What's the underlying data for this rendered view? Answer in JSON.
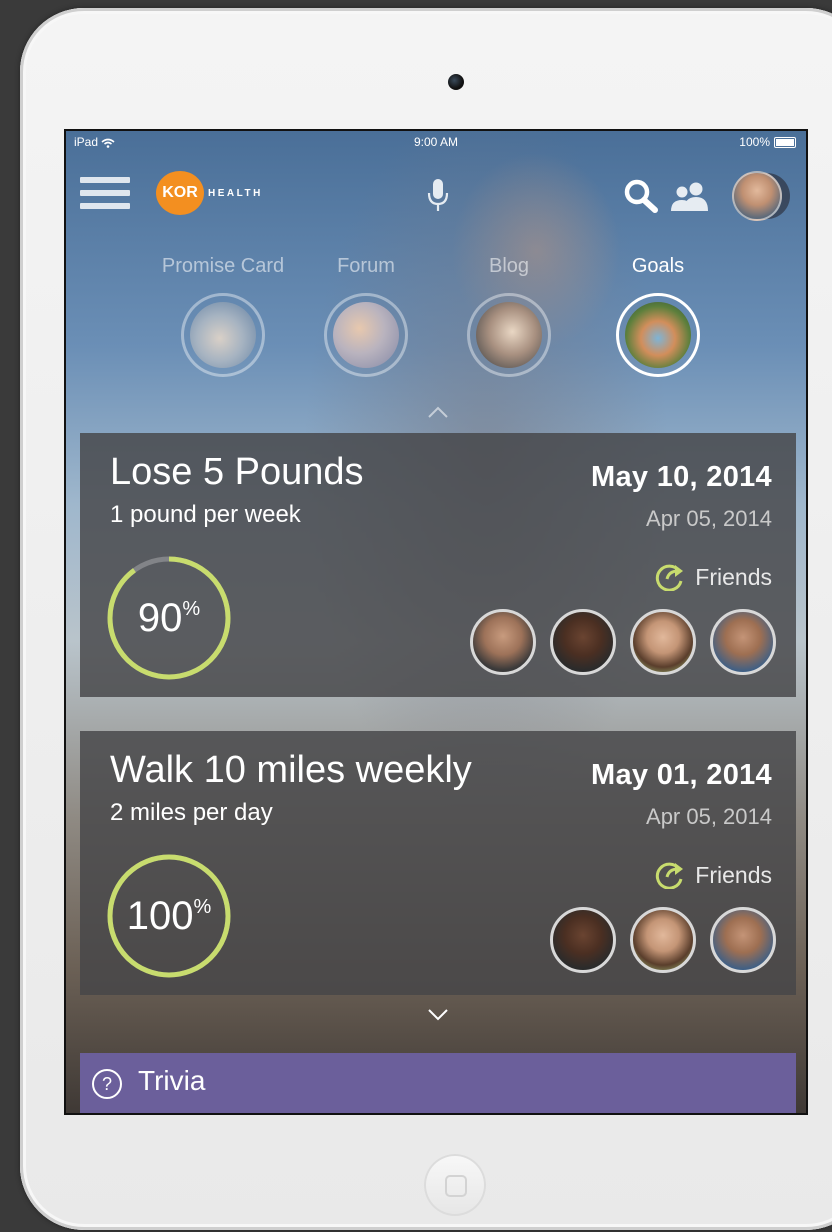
{
  "status_bar": {
    "device": "iPad",
    "time": "9:00 AM",
    "battery": "100%"
  },
  "header": {
    "logo_badge": "KOR",
    "logo_text": "HEALTH",
    "icons": [
      "menu-icon",
      "microphone-icon",
      "search-icon",
      "people-icon",
      "user-avatar"
    ]
  },
  "tabs": [
    {
      "label": "Promise Card",
      "active": false
    },
    {
      "label": "Forum",
      "active": false
    },
    {
      "label": "Blog",
      "active": false
    },
    {
      "label": "Goals",
      "active": true
    }
  ],
  "goals": [
    {
      "title": "Lose 5 Pounds",
      "subtitle": "1 pound per week",
      "target_date": "May 10, 2014",
      "start_date": "Apr 05, 2014",
      "progress": 90,
      "progress_unit": "%",
      "friends_label": "Friends",
      "friend_count": 4
    },
    {
      "title": "Walk 10 miles weekly",
      "subtitle": "2 miles per day",
      "target_date": "May 01, 2014",
      "start_date": "Apr 05, 2014",
      "progress": 100,
      "progress_unit": "%",
      "friends_label": "Friends",
      "friend_count": 3
    }
  ],
  "trivia": {
    "icon": "?",
    "label": "Trivia"
  },
  "colors": {
    "accent_orange": "#f38f20",
    "progress_green": "#c8dc6e",
    "card_bg": "#464648",
    "trivia_bg": "#6b5f9b"
  }
}
